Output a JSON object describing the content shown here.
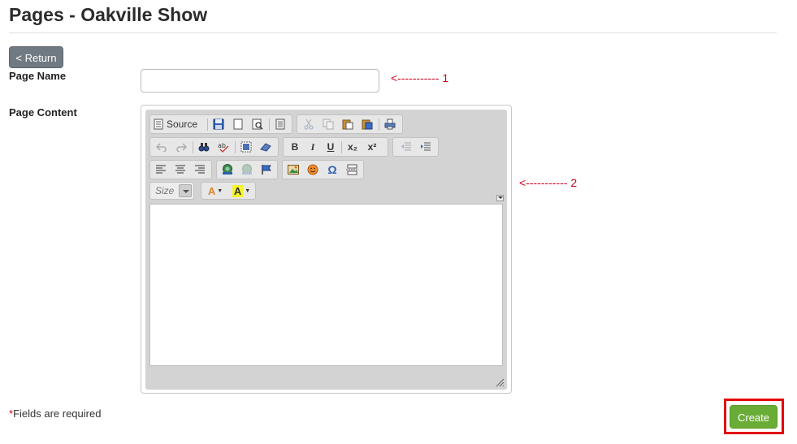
{
  "page": {
    "title": "Pages - Oakville Show",
    "return_label": "< Return"
  },
  "form": {
    "page_name_label": "Page Name",
    "page_name_value": "",
    "page_content_label": "Page Content",
    "required_star": "*",
    "required_text": "Fields are required",
    "create_label": "Create"
  },
  "annotations": {
    "arrow_1": "<----------- 1",
    "arrow_2": "<----------- 2"
  },
  "editor": {
    "source_label": "Source",
    "size_label": "Size",
    "row1": [
      "source-icon",
      "save-icon",
      "new-page-icon",
      "preview-icon",
      "templates-icon",
      "cut-icon",
      "copy-icon",
      "paste-icon",
      "paste-word-icon",
      "print-icon"
    ],
    "row2": [
      "undo-icon",
      "redo-icon",
      "find-icon",
      "spellcheck-icon",
      "select-all-icon",
      "remove-format-icon",
      "bold-icon",
      "italic-icon",
      "underline-icon",
      "subscript-icon",
      "superscript-icon",
      "outdent-icon",
      "indent-icon"
    ],
    "row3": [
      "align-left-icon",
      "align-center-icon",
      "align-right-icon",
      "link-icon",
      "unlink-icon",
      "anchor-icon",
      "image-icon",
      "smiley-icon",
      "special-char-icon",
      "page-break-icon"
    ],
    "row4": [
      "font-size-combo",
      "text-color-icon",
      "background-color-icon"
    ],
    "bold": "B",
    "italic": "I",
    "underline": "U",
    "subscript": "x₂",
    "superscript": "x²",
    "omega": "Ω",
    "text_color_glyph": "A",
    "bg_color_glyph": "A"
  },
  "colors": {
    "create_button": "#6aad36",
    "return_button": "#6f7a82",
    "annotation": "#d0021b",
    "highlight_box": "#e30000"
  }
}
